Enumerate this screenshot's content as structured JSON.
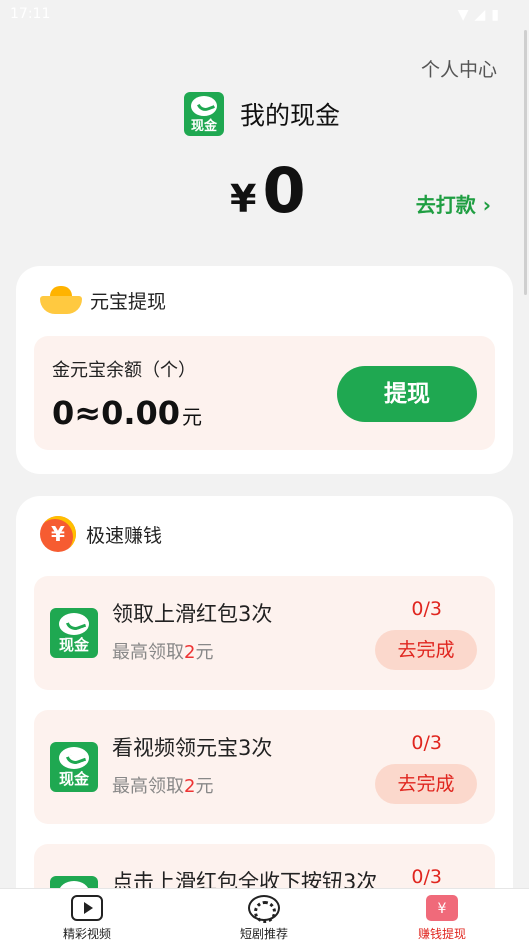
{
  "status_bar": {
    "time": "17:11"
  },
  "header": {
    "personal_center": "个人中心",
    "title": "我的现金",
    "cash_icon_text": "现金"
  },
  "balance": {
    "currency": "¥",
    "amount": "0",
    "go_shop": "去打款"
  },
  "yuanbao": {
    "section_title": "元宝提现",
    "balance_label": "金元宝余额（个）",
    "balance_value": "0≈0.00",
    "balance_unit": "元",
    "withdraw_button": "提现"
  },
  "speed": {
    "section_title": "极速赚钱",
    "yen_symbol": "¥",
    "tasks": [
      {
        "title": "领取上滑红包3次",
        "sub_prefix": "最高领取",
        "sub_amount": "2",
        "sub_unit": "元",
        "progress": "0/3",
        "button": "去完成"
      },
      {
        "title": "看视频领元宝3次",
        "sub_prefix": "最高领取",
        "sub_amount": "2",
        "sub_unit": "元",
        "progress": "0/3",
        "button": "去完成"
      },
      {
        "title": "点击上滑红包全收下按钮3次",
        "progress": "0/3"
      }
    ]
  },
  "nav": {
    "items": [
      {
        "label": "精彩视频",
        "icon": "video-icon"
      },
      {
        "label": "短剧推荐",
        "icon": "film-reel-icon"
      },
      {
        "label": "赚钱提现",
        "icon": "red-envelope-icon"
      }
    ],
    "active_index": 2
  },
  "colors": {
    "brand_green": "#1fa851",
    "accent_red": "#e0261f",
    "task_bg": "#fdf2ee"
  }
}
